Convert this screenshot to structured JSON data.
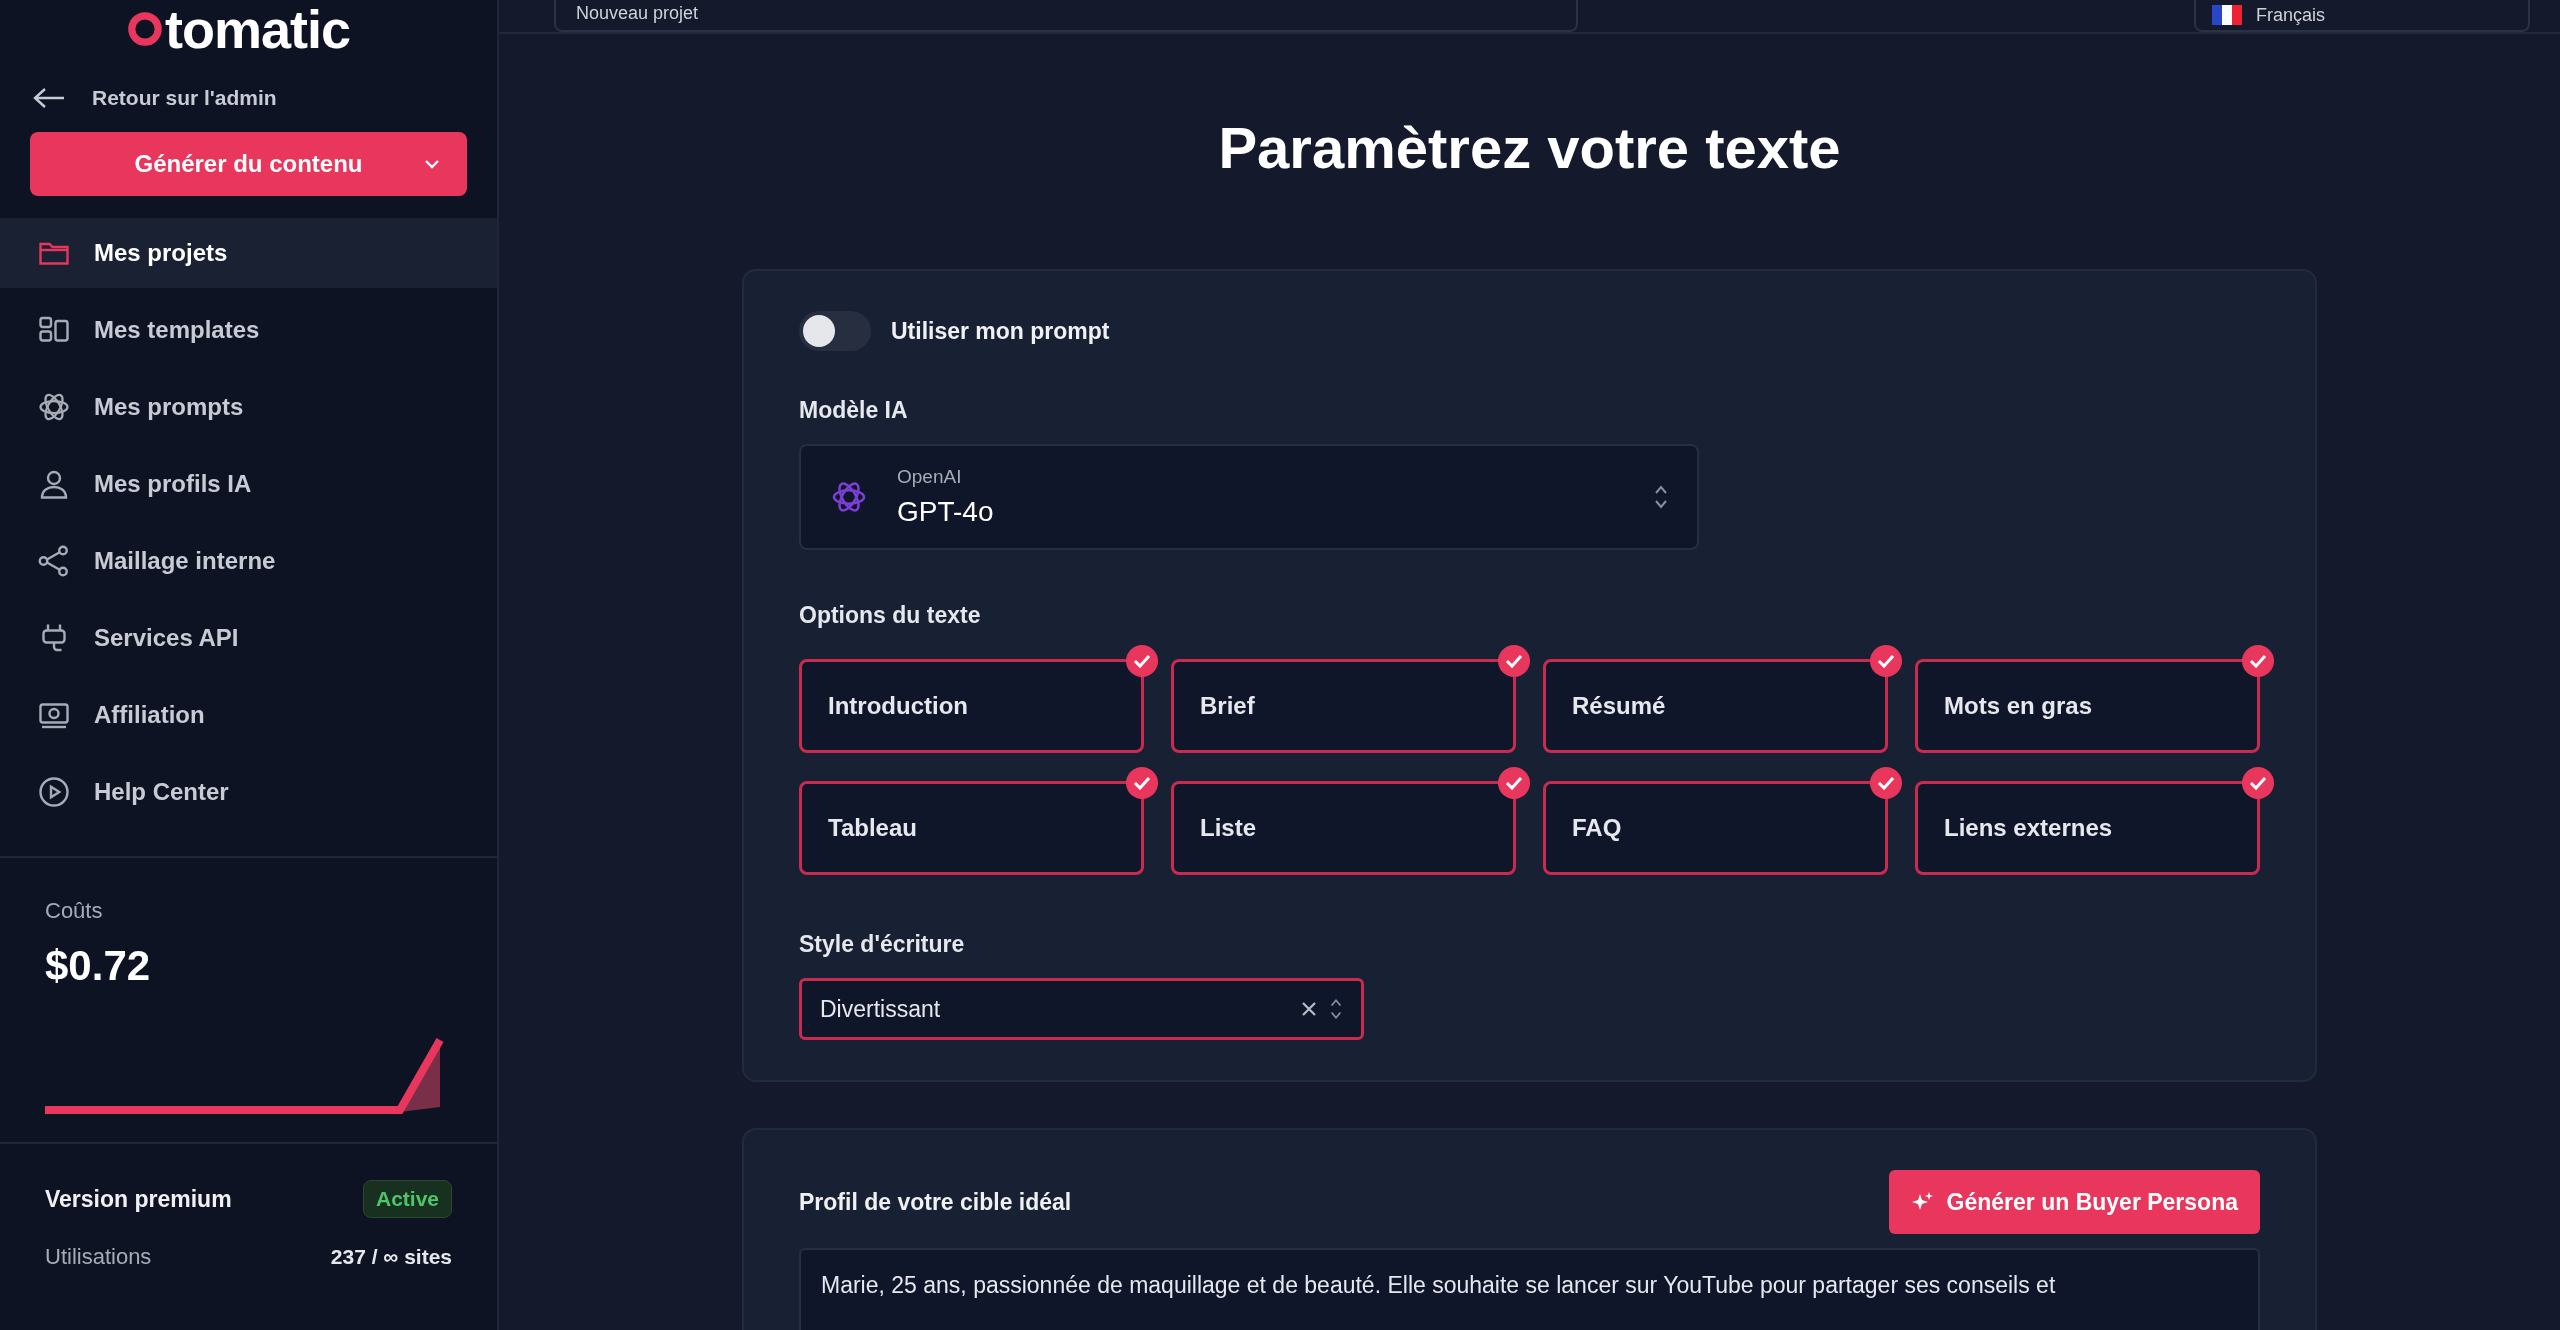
{
  "sidebar": {
    "logo": "tomatic",
    "back_link": "Retour sur l'admin",
    "generate_button": "Générer du contenu",
    "items": [
      {
        "label": "Mes projets",
        "selected": true
      },
      {
        "label": "Mes templates",
        "selected": false
      },
      {
        "label": "Mes prompts",
        "selected": false
      },
      {
        "label": "Mes profils IA",
        "selected": false
      },
      {
        "label": "Maillage interne",
        "selected": false
      },
      {
        "label": "Services API",
        "selected": false
      },
      {
        "label": "Affiliation",
        "selected": false
      },
      {
        "label": "Help Center",
        "selected": false
      }
    ],
    "costs": {
      "label": "Coûts",
      "amount": "$0.72"
    },
    "plan": {
      "label": "Version premium",
      "status": "Active",
      "usage_label": "Utilisations",
      "usage": "237 / ∞ sites"
    }
  },
  "topbar": {
    "project_name": "Nouveau projet",
    "language": "Français"
  },
  "page_title": "Paramètrez votre texte",
  "settings": {
    "toggle": {
      "label": "Utiliser mon prompt",
      "on": false
    },
    "model_label": "Modèle IA",
    "model": {
      "provider": "OpenAI",
      "name": "GPT-4o"
    },
    "options_label": "Options du texte",
    "options": [
      {
        "label": "Introduction",
        "checked": true
      },
      {
        "label": "Brief",
        "checked": true
      },
      {
        "label": "Résumé",
        "checked": true
      },
      {
        "label": "Mots en gras",
        "checked": true
      },
      {
        "label": "Tableau",
        "checked": true
      },
      {
        "label": "Liste",
        "checked": true
      },
      {
        "label": "FAQ",
        "checked": true
      },
      {
        "label": "Liens externes",
        "checked": true
      }
    ],
    "style_label": "Style d'écriture",
    "style_value": "Divertissant"
  },
  "persona": {
    "label": "Profil de votre cible idéal",
    "button": "Générer un Buyer Persona",
    "text": "Marie, 25 ans, passionnée de maquillage et de beauté. Elle souhaite se lancer sur YouTube pour partager ses conseils et"
  }
}
